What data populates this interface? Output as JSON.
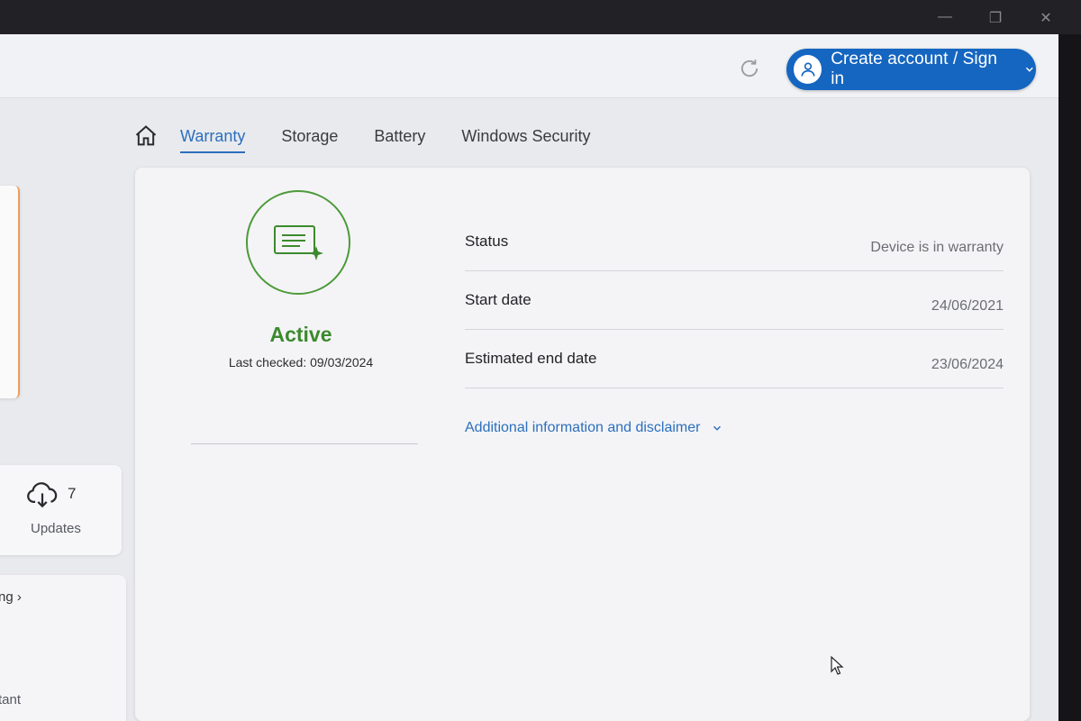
{
  "header": {
    "account_button_label": "Create account / Sign in"
  },
  "nav": {
    "tabs": [
      {
        "label": "Warranty",
        "active": true
      },
      {
        "label": "Storage",
        "active": false
      },
      {
        "label": "Battery",
        "active": false
      },
      {
        "label": "Windows Security",
        "active": false
      }
    ]
  },
  "sidebar": {
    "updates_count": "7",
    "updates_label": "Updates",
    "partial_link": "ng ›",
    "partial_bottom": "tant"
  },
  "warranty": {
    "status_title": "Active",
    "last_checked": "Last checked: 09/03/2024",
    "rows": [
      {
        "label": "Status",
        "value": "Device is in warranty"
      },
      {
        "label": "Start date",
        "value": "24/06/2021"
      },
      {
        "label": "Estimated end date",
        "value": "23/06/2024"
      }
    ],
    "disclaimer_label": "Additional information and disclaimer"
  },
  "colors": {
    "accent": "#2c6fbd",
    "account_button": "#1566c0",
    "status_green": "#3c8a2e"
  },
  "icons": [
    "refresh-icon",
    "user-icon",
    "chevron-down-icon",
    "home-icon",
    "cloud-download-icon",
    "warranty-document-icon",
    "mouse-cursor-icon"
  ]
}
